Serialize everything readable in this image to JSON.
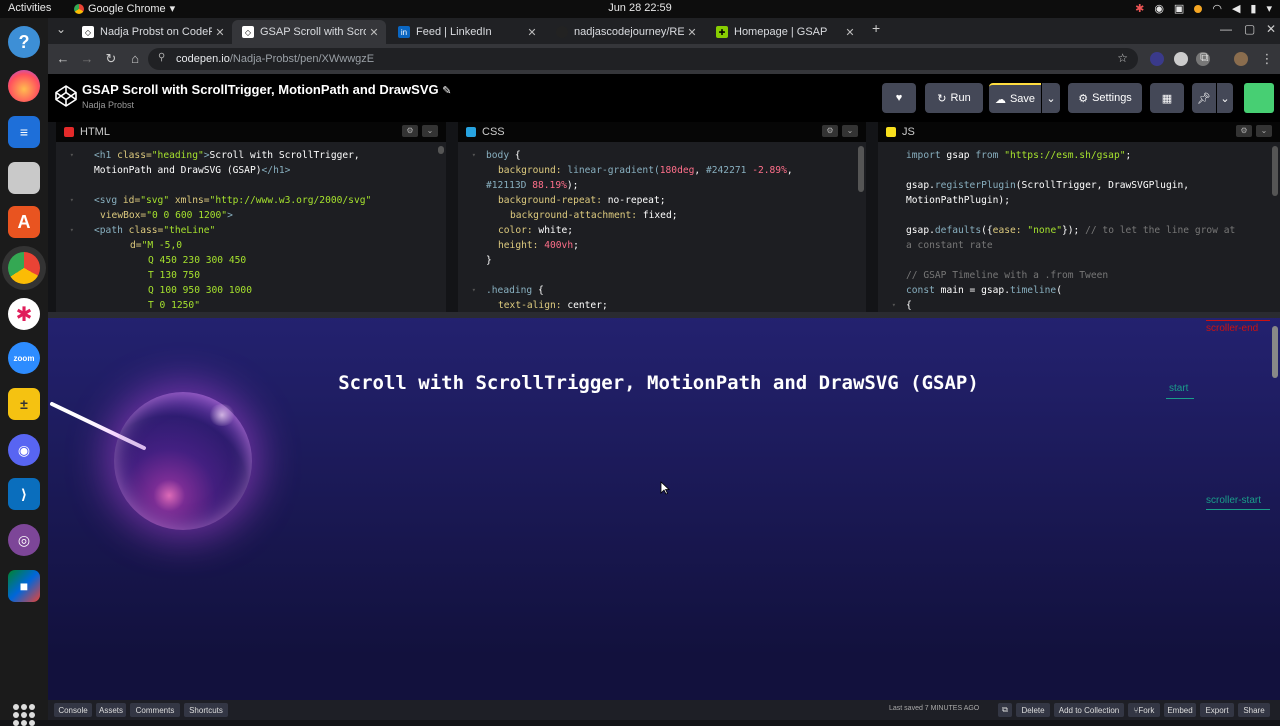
{
  "system": {
    "activities": "Activities",
    "app_name": "Google Chrome",
    "clock": "Jun 28  22:59"
  },
  "browser": {
    "tabs": [
      {
        "title": "Nadja Probst on CodePe",
        "favicon": "codepen-icon"
      },
      {
        "title": "GSAP Scroll with ScrollTr",
        "favicon": "codepen-icon",
        "active": true
      },
      {
        "title": "Feed | LinkedIn",
        "favicon": "linkedin-icon"
      },
      {
        "title": "nadjascodejourney/REA",
        "favicon": "github-icon"
      },
      {
        "title": "Homepage | GSAP",
        "favicon": "gsap-icon"
      }
    ],
    "url_host": "codepen.io",
    "url_path": "/Nadja-Probst/pen/XWwwgzE"
  },
  "codepen": {
    "title": "GSAP Scroll with ScrollTrigger, MotionPath and DrawSVG",
    "author": "Nadja Probst",
    "run_label": "Run",
    "save_label": "Save",
    "settings_label": "Settings"
  },
  "editors": {
    "html_label": "HTML",
    "css_label": "CSS",
    "js_label": "JS"
  },
  "preview": {
    "heading": "Scroll with ScrollTrigger, MotionPath and DrawSVG (GSAP)",
    "marker_scroller_end": "scroller-end",
    "marker_start": "start",
    "marker_scroller_start": "scroller-start"
  },
  "footer": {
    "console": "Console",
    "assets": "Assets",
    "comments": "Comments",
    "shortcuts": "Shortcuts",
    "last_saved": "Last saved 7 MINUTES AGO",
    "delete": "Delete",
    "add_to_collection": "Add to Collection",
    "fork": "Fork",
    "embed": "Embed",
    "export": "Export",
    "share": "Share"
  },
  "colors": {
    "bg_gradient_top": "#242271",
    "bg_gradient_bottom": "#12113D",
    "codepen_green": "#47cf73"
  }
}
